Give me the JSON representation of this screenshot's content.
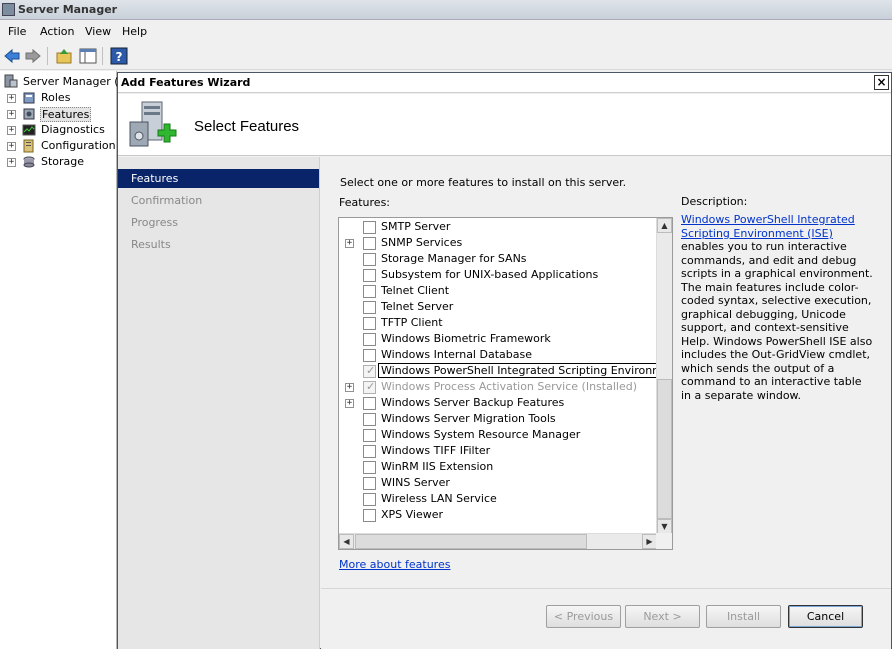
{
  "server_manager": {
    "title": "Server Manager",
    "menu": [
      "File",
      "Action",
      "View",
      "Help"
    ],
    "toolbar_icons": [
      "back-icon",
      "forward-icon",
      "up-folder-icon",
      "show-hide-console-tree-icon",
      "help-icon"
    ],
    "tree": {
      "root": "Server Manager (S",
      "items": [
        {
          "label": "Roles",
          "icon": "roles-icon"
        },
        {
          "label": "Features",
          "icon": "features-icon",
          "selected": true
        },
        {
          "label": "Diagnostics",
          "icon": "diagnostics-icon"
        },
        {
          "label": "Configuration",
          "icon": "configuration-icon"
        },
        {
          "label": "Storage",
          "icon": "storage-icon"
        }
      ]
    }
  },
  "wizard": {
    "title": "Add Features Wizard",
    "close_label": "×",
    "heading": "Select Features",
    "nav": [
      "Features",
      "Confirmation",
      "Progress",
      "Results"
    ],
    "instruction": "Select one or more features to install on this server.",
    "features_label": "Features:",
    "features": [
      {
        "label": "SMTP Server",
        "expandable": false,
        "checked": false,
        "disabled": false
      },
      {
        "label": "SNMP Services",
        "expandable": true,
        "checked": false,
        "disabled": false
      },
      {
        "label": "Storage Manager for SANs",
        "expandable": false,
        "checked": false,
        "disabled": false
      },
      {
        "label": "Subsystem for UNIX-based Applications",
        "expandable": false,
        "checked": false,
        "disabled": false
      },
      {
        "label": "Telnet Client",
        "expandable": false,
        "checked": false,
        "disabled": false
      },
      {
        "label": "Telnet Server",
        "expandable": false,
        "checked": false,
        "disabled": false
      },
      {
        "label": "TFTP Client",
        "expandable": false,
        "checked": false,
        "disabled": false
      },
      {
        "label": "Windows Biometric Framework",
        "expandable": false,
        "checked": false,
        "disabled": false
      },
      {
        "label": "Windows Internal Database",
        "expandable": false,
        "checked": false,
        "disabled": false
      },
      {
        "label": "Windows PowerShell Integrated Scripting Environment (ISE)  (Installed)",
        "expandable": false,
        "checked": true,
        "disabled": true,
        "focused": true
      },
      {
        "label": "Windows Process Activation Service  (Installed)",
        "expandable": true,
        "checked": true,
        "disabled": true
      },
      {
        "label": "Windows Server Backup Features",
        "expandable": true,
        "checked": false,
        "disabled": false
      },
      {
        "label": "Windows Server Migration Tools",
        "expandable": false,
        "checked": false,
        "disabled": false
      },
      {
        "label": "Windows System Resource Manager",
        "expandable": false,
        "checked": false,
        "disabled": false
      },
      {
        "label": "Windows TIFF IFilter",
        "expandable": false,
        "checked": false,
        "disabled": false
      },
      {
        "label": "WinRM IIS Extension",
        "expandable": false,
        "checked": false,
        "disabled": false
      },
      {
        "label": "WINS Server",
        "expandable": false,
        "checked": false,
        "disabled": false
      },
      {
        "label": "Wireless LAN Service",
        "expandable": false,
        "checked": false,
        "disabled": false
      },
      {
        "label": "XPS Viewer",
        "expandable": false,
        "checked": false,
        "disabled": false
      }
    ],
    "description_label": "Description:",
    "description_link": "Windows PowerShell Integrated Scripting Environment (ISE)",
    "description_body": " enables you to run interactive commands, and edit and debug scripts in a graphical environment. The main features include color-coded syntax, selective execution, graphical debugging, Unicode support, and context-sensitive Help. Windows PowerShell ISE also includes the Out-GridView cmdlet, which sends the output of a command to an interactive table in a separate window.",
    "more_link": "More about features",
    "buttons": {
      "previous": "< Previous",
      "next": "Next >",
      "install": "Install",
      "cancel": "Cancel"
    }
  }
}
